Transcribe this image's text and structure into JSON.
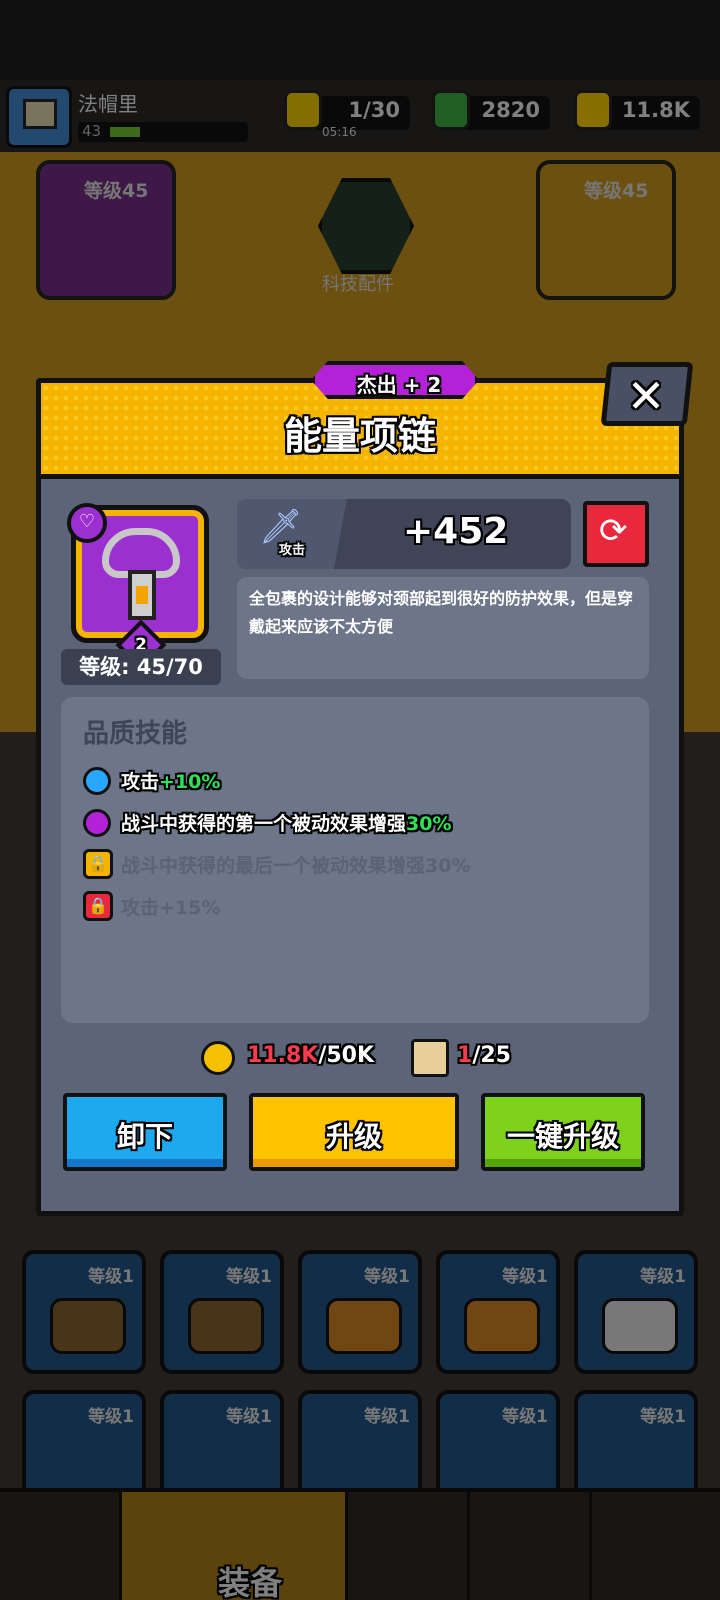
{
  "player": {
    "name": "法帽里",
    "level": "43"
  },
  "resources": {
    "energy": "1/30",
    "energy_timer": "05:16",
    "gems": "2820",
    "coins": "11.8K"
  },
  "background": {
    "slot_level_top": "等级45",
    "tech_parts": "科技配件",
    "bottom_slot_levels": [
      "等级1",
      "等级1",
      "等级1",
      "等级1",
      "等级1",
      "等级1",
      "等级1",
      "等级1",
      "等级1",
      "等级1"
    ],
    "equip_tab": "装备"
  },
  "modal": {
    "rarity": "杰出 + 2",
    "title": "能量项链",
    "close": "✕",
    "item_stack": "2",
    "item_level": "等级: 45/70",
    "stat_label": "攻击",
    "stat_value": "+452",
    "description": "全包裹的设计能够对颈部起到很好的防护效果，但是穿戴起来应该不太方便",
    "skills_title": "品质技能",
    "skills": [
      {
        "text": "攻击",
        "bonus": "+10%"
      },
      {
        "text": "战斗中获得的第一个被动效果增强",
        "bonus": "30%"
      },
      {
        "text": "战斗中获得的最后一个被动效果增强30%",
        "bonus": ""
      },
      {
        "text": "攻击+15%",
        "bonus": ""
      }
    ],
    "cost": {
      "coins_have": "11.8K",
      "coins_need": "/50K",
      "scroll_have": "1",
      "scroll_need": "/25"
    },
    "buttons": {
      "unequip": "卸下",
      "upgrade": "升级",
      "one_click": "一键升级"
    }
  },
  "colors": {
    "rarity_purple": "#b322d6",
    "header_yellow": "#f5b400",
    "bonus_green": "#2ee05a",
    "insufficient_red": "#ff3b4e"
  }
}
